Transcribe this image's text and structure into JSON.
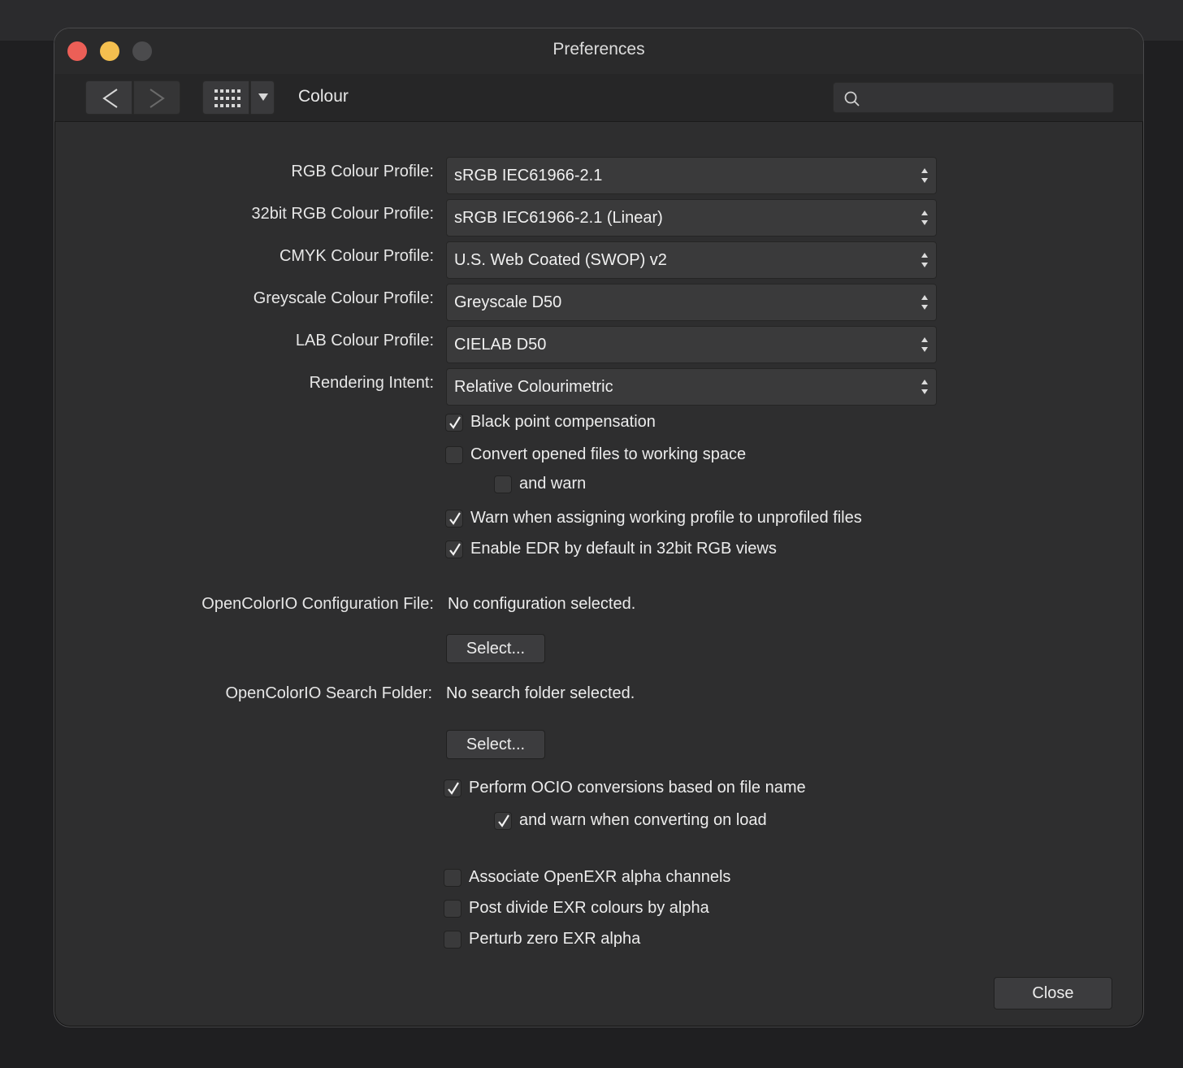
{
  "window": {
    "title": "Preferences"
  },
  "toolbar": {
    "back_icon": "chevron-left-icon",
    "forward_icon": "chevron-right-icon",
    "grid_icon": "grid-icon",
    "dropdown_icon": "chevron-down-icon",
    "breadcrumb": "Colour",
    "search": {
      "value": "",
      "placeholder": ""
    }
  },
  "profiles": [
    {
      "label": "RGB Colour Profile:",
      "value": "sRGB IEC61966-2.1"
    },
    {
      "label": "32bit RGB Colour Profile:",
      "value": "sRGB IEC61966-2.1 (Linear)"
    },
    {
      "label": "CMYK Colour Profile:",
      "value": "U.S. Web Coated (SWOP) v2"
    },
    {
      "label": "Greyscale Colour Profile:",
      "value": "Greyscale D50"
    },
    {
      "label": "LAB Colour Profile:",
      "value": "CIELAB D50"
    },
    {
      "label": "Rendering Intent:",
      "value": "Relative Colourimetric"
    }
  ],
  "checkboxes_1": [
    {
      "label": "Black point compensation",
      "checked": true
    },
    {
      "label": "Convert opened files to working space",
      "checked": false
    },
    {
      "label": "and warn",
      "checked": false
    },
    {
      "label": "Warn when assigning working profile to unprofiled files",
      "checked": true
    },
    {
      "label": "Enable EDR by default in 32bit RGB views",
      "checked": true
    }
  ],
  "ocio": {
    "config_label": "OpenColorIO Configuration File:",
    "config_value": "No configuration selected.",
    "select_label": "Select...",
    "folder_label": "OpenColorIO Search Folder:",
    "folder_value": "No search folder selected.",
    "select_folder_label": "Select..."
  },
  "checkboxes_2": [
    {
      "label": "Perform OCIO conversions based on file name",
      "checked": true
    },
    {
      "label": "and warn when converting on load",
      "checked": true
    },
    {
      "label": "Associate OpenEXR alpha channels",
      "checked": false
    },
    {
      "label": "Post divide EXR colours by alpha",
      "checked": false
    },
    {
      "label": "Perturb zero EXR alpha",
      "checked": false
    }
  ],
  "footer": {
    "close_label": "Close"
  },
  "colors": {
    "close": "#ec5f57",
    "minimize": "#f4bf4f",
    "zoom_disabled": "#4b4b4d"
  }
}
